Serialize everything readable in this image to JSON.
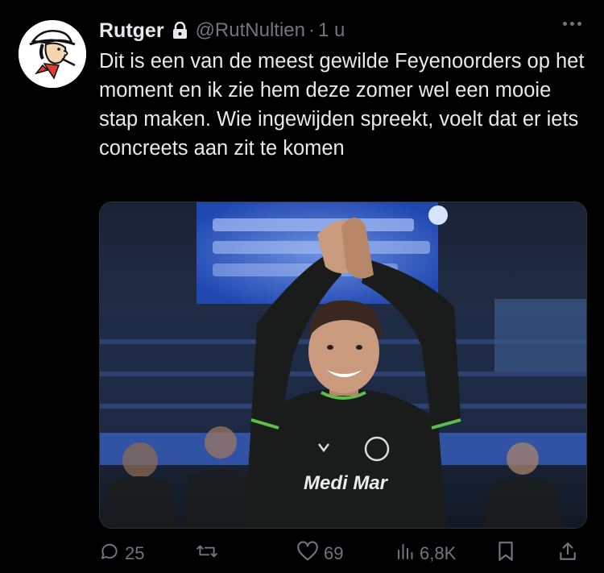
{
  "tweet": {
    "author_name": "Rutger",
    "handle": "@RutNultien",
    "separator": "·",
    "time": "1 u",
    "text": "Dit is een van de meest gewilde Feyenoorders op het moment en ik zie hem deze zomer wel een mooie stap maken. Wie ingewijden spreekt, voelt dat er iets concreets aan zit te komen",
    "image": {
      "sponsor_text": "Medi Mar",
      "colors": {
        "shirt": "#1a1c1b",
        "trim": "#5bbf4a",
        "stadium_blue": "#2a5bc4"
      }
    }
  },
  "actions": {
    "replies": "25",
    "retweets": "",
    "likes": "69",
    "views": "6,8K"
  },
  "icons": [
    "lock-icon",
    "more-icon",
    "reply-icon",
    "retweet-icon",
    "like-icon",
    "views-icon",
    "bookmark-icon",
    "share-icon"
  ],
  "colors": {
    "background": "#000000",
    "text": "#e7e9ea",
    "muted": "#71767b"
  }
}
